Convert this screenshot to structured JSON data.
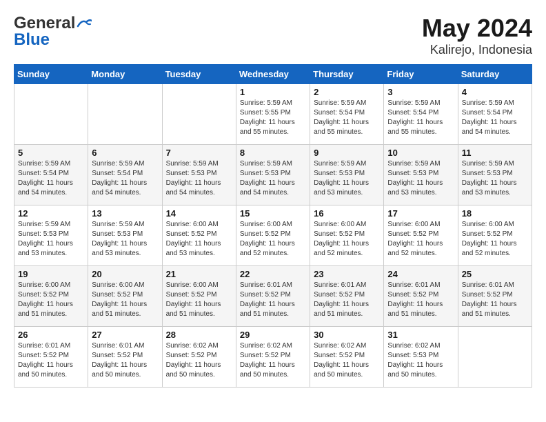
{
  "header": {
    "logo_general": "General",
    "logo_blue": "Blue",
    "month": "May 2024",
    "location": "Kalirejo, Indonesia"
  },
  "days_of_week": [
    "Sunday",
    "Monday",
    "Tuesday",
    "Wednesday",
    "Thursday",
    "Friday",
    "Saturday"
  ],
  "weeks": [
    [
      {
        "day": "",
        "info": ""
      },
      {
        "day": "",
        "info": ""
      },
      {
        "day": "",
        "info": ""
      },
      {
        "day": "1",
        "info": "Sunrise: 5:59 AM\nSunset: 5:55 PM\nDaylight: 11 hours\nand 55 minutes."
      },
      {
        "day": "2",
        "info": "Sunrise: 5:59 AM\nSunset: 5:54 PM\nDaylight: 11 hours\nand 55 minutes."
      },
      {
        "day": "3",
        "info": "Sunrise: 5:59 AM\nSunset: 5:54 PM\nDaylight: 11 hours\nand 55 minutes."
      },
      {
        "day": "4",
        "info": "Sunrise: 5:59 AM\nSunset: 5:54 PM\nDaylight: 11 hours\nand 54 minutes."
      }
    ],
    [
      {
        "day": "5",
        "info": "Sunrise: 5:59 AM\nSunset: 5:54 PM\nDaylight: 11 hours\nand 54 minutes."
      },
      {
        "day": "6",
        "info": "Sunrise: 5:59 AM\nSunset: 5:54 PM\nDaylight: 11 hours\nand 54 minutes."
      },
      {
        "day": "7",
        "info": "Sunrise: 5:59 AM\nSunset: 5:53 PM\nDaylight: 11 hours\nand 54 minutes."
      },
      {
        "day": "8",
        "info": "Sunrise: 5:59 AM\nSunset: 5:53 PM\nDaylight: 11 hours\nand 54 minutes."
      },
      {
        "day": "9",
        "info": "Sunrise: 5:59 AM\nSunset: 5:53 PM\nDaylight: 11 hours\nand 53 minutes."
      },
      {
        "day": "10",
        "info": "Sunrise: 5:59 AM\nSunset: 5:53 PM\nDaylight: 11 hours\nand 53 minutes."
      },
      {
        "day": "11",
        "info": "Sunrise: 5:59 AM\nSunset: 5:53 PM\nDaylight: 11 hours\nand 53 minutes."
      }
    ],
    [
      {
        "day": "12",
        "info": "Sunrise: 5:59 AM\nSunset: 5:53 PM\nDaylight: 11 hours\nand 53 minutes."
      },
      {
        "day": "13",
        "info": "Sunrise: 5:59 AM\nSunset: 5:53 PM\nDaylight: 11 hours\nand 53 minutes."
      },
      {
        "day": "14",
        "info": "Sunrise: 6:00 AM\nSunset: 5:52 PM\nDaylight: 11 hours\nand 53 minutes."
      },
      {
        "day": "15",
        "info": "Sunrise: 6:00 AM\nSunset: 5:52 PM\nDaylight: 11 hours\nand 52 minutes."
      },
      {
        "day": "16",
        "info": "Sunrise: 6:00 AM\nSunset: 5:52 PM\nDaylight: 11 hours\nand 52 minutes."
      },
      {
        "day": "17",
        "info": "Sunrise: 6:00 AM\nSunset: 5:52 PM\nDaylight: 11 hours\nand 52 minutes."
      },
      {
        "day": "18",
        "info": "Sunrise: 6:00 AM\nSunset: 5:52 PM\nDaylight: 11 hours\nand 52 minutes."
      }
    ],
    [
      {
        "day": "19",
        "info": "Sunrise: 6:00 AM\nSunset: 5:52 PM\nDaylight: 11 hours\nand 51 minutes."
      },
      {
        "day": "20",
        "info": "Sunrise: 6:00 AM\nSunset: 5:52 PM\nDaylight: 11 hours\nand 51 minutes."
      },
      {
        "day": "21",
        "info": "Sunrise: 6:00 AM\nSunset: 5:52 PM\nDaylight: 11 hours\nand 51 minutes."
      },
      {
        "day": "22",
        "info": "Sunrise: 6:01 AM\nSunset: 5:52 PM\nDaylight: 11 hours\nand 51 minutes."
      },
      {
        "day": "23",
        "info": "Sunrise: 6:01 AM\nSunset: 5:52 PM\nDaylight: 11 hours\nand 51 minutes."
      },
      {
        "day": "24",
        "info": "Sunrise: 6:01 AM\nSunset: 5:52 PM\nDaylight: 11 hours\nand 51 minutes."
      },
      {
        "day": "25",
        "info": "Sunrise: 6:01 AM\nSunset: 5:52 PM\nDaylight: 11 hours\nand 51 minutes."
      }
    ],
    [
      {
        "day": "26",
        "info": "Sunrise: 6:01 AM\nSunset: 5:52 PM\nDaylight: 11 hours\nand 50 minutes."
      },
      {
        "day": "27",
        "info": "Sunrise: 6:01 AM\nSunset: 5:52 PM\nDaylight: 11 hours\nand 50 minutes."
      },
      {
        "day": "28",
        "info": "Sunrise: 6:02 AM\nSunset: 5:52 PM\nDaylight: 11 hours\nand 50 minutes."
      },
      {
        "day": "29",
        "info": "Sunrise: 6:02 AM\nSunset: 5:52 PM\nDaylight: 11 hours\nand 50 minutes."
      },
      {
        "day": "30",
        "info": "Sunrise: 6:02 AM\nSunset: 5:52 PM\nDaylight: 11 hours\nand 50 minutes."
      },
      {
        "day": "31",
        "info": "Sunrise: 6:02 AM\nSunset: 5:53 PM\nDaylight: 11 hours\nand 50 minutes."
      },
      {
        "day": "",
        "info": ""
      }
    ]
  ]
}
